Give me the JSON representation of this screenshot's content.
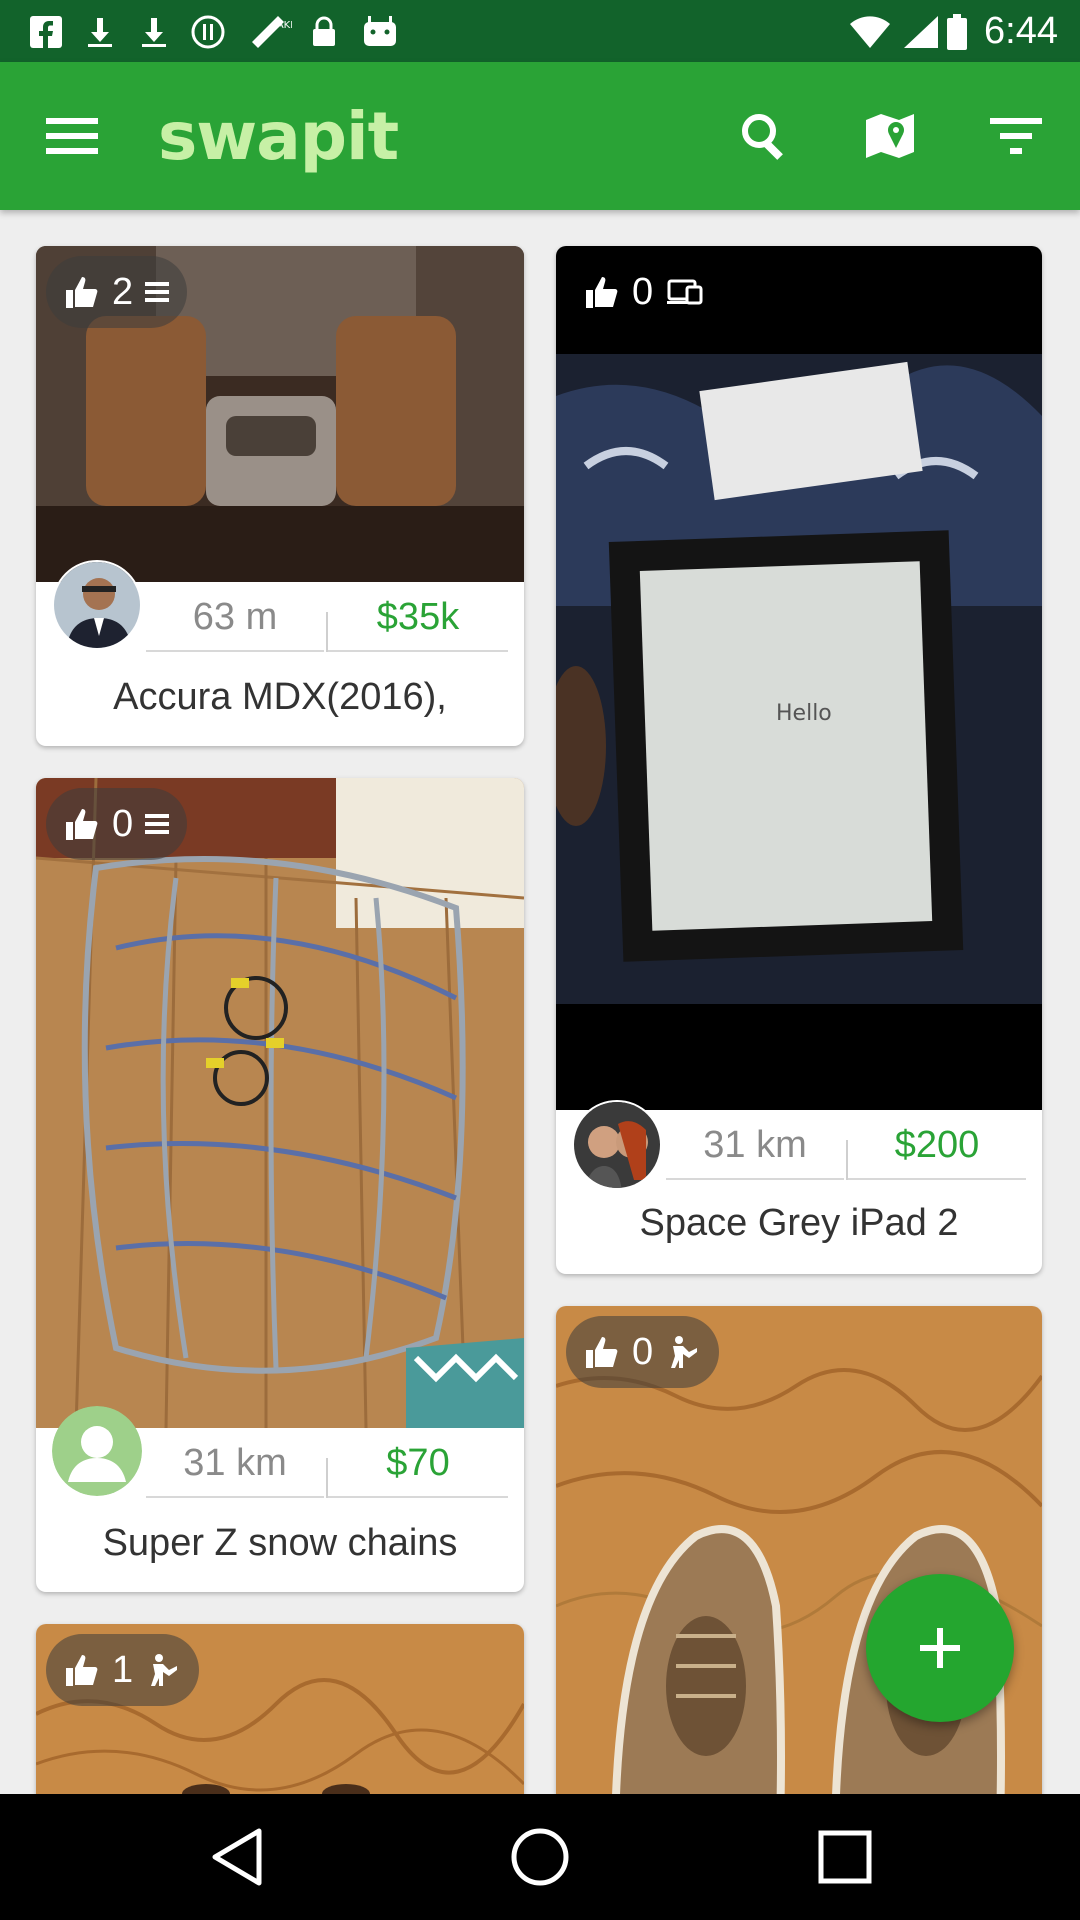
{
  "status_bar": {
    "time": "6:44",
    "icons": [
      "facebook-icon",
      "download-icon",
      "sync-icon",
      "fake-gps-icon",
      "lock-icon",
      "android-icon",
      "wifi-icon",
      "signal-icon",
      "battery-icon"
    ]
  },
  "app_bar": {
    "logo": "swapit",
    "actions": [
      "menu-icon",
      "search-icon",
      "map-icon",
      "filter-icon"
    ]
  },
  "colors": {
    "status_bar": "#12632b",
    "app_bar": "#2aa336",
    "logo": "#c7f0a6",
    "price": "#2aa336",
    "fab": "#24a62f"
  },
  "listings": [
    {
      "likes": "2",
      "category_icon": "list-icon",
      "distance": "63 m",
      "price": "$35k",
      "title": "Accura MDX(2016),"
    },
    {
      "likes": "0",
      "category_icon": "electronics-icon",
      "distance": "31 km",
      "price": "$200",
      "title": "Space Grey iPad 2",
      "photo_text": "Hello"
    },
    {
      "likes": "0",
      "category_icon": "list-icon",
      "distance": "31 km",
      "price": "$70",
      "title": "Super Z snow chains"
    },
    {
      "likes": "0",
      "category_icon": "clothing-icon"
    },
    {
      "likes": "1",
      "category_icon": "clothing-icon"
    }
  ],
  "fab": {
    "icon": "plus-icon"
  },
  "nav": [
    "back-icon",
    "home-icon",
    "recents-icon"
  ]
}
